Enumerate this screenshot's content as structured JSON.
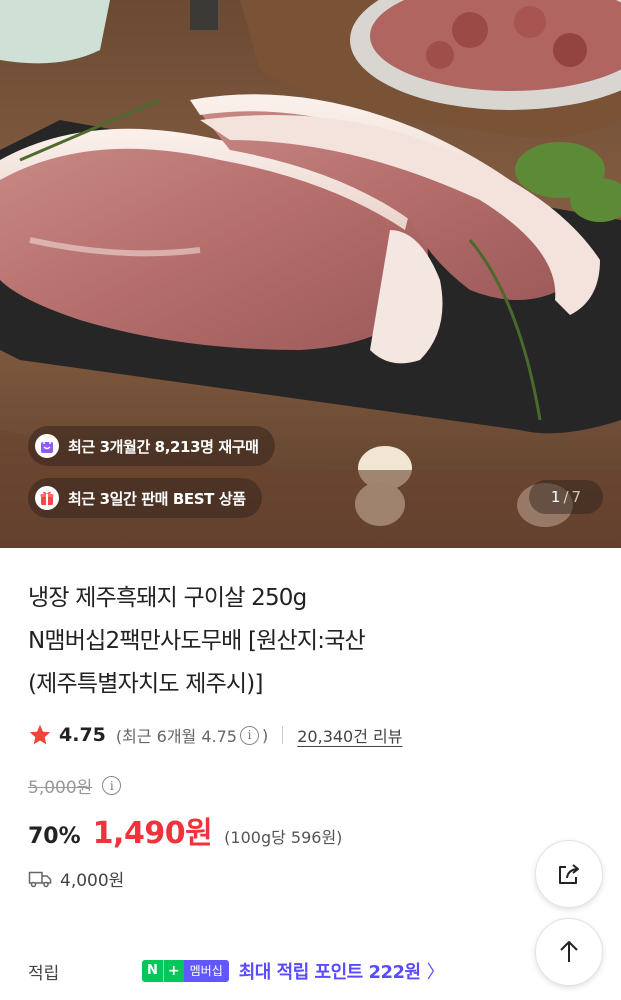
{
  "hero": {
    "badges": {
      "rebuy": {
        "icon": "shopping-bag-icon",
        "text": "최근 3개월간 8,213명 재구매"
      },
      "best": {
        "icon": "gift-icon",
        "text": "최근 3일간 판매 BEST 상품"
      }
    },
    "counter": {
      "current": "1",
      "separator": "/",
      "total": "7"
    }
  },
  "product": {
    "title_lines": [
      "냉장 제주흑돼지 구이살 250g",
      "N맴버십2팩만사도무배 [원산지:국산",
      "(제주특별자치도 제주시)]"
    ]
  },
  "rating": {
    "score": "4.75",
    "recent_prefix": "(최근 6개월 4.75",
    "recent_suffix": ")",
    "info_glyph": "i",
    "reviews": "20,340건 리뷰",
    "star_color": "#f04438"
  },
  "price": {
    "original": "5,000원",
    "info_glyph": "i",
    "discount": "70%",
    "sale": "1,490원",
    "unit": "(100g당 596원)",
    "sale_color": "#f0323c"
  },
  "shipping": {
    "icon": "delivery-truck-icon",
    "fee": "4,000원"
  },
  "points": {
    "label": "적립",
    "badge_n": "N",
    "badge_plus": "+",
    "badge_member": "멤버십",
    "text": "최대 적립 포인트 222원",
    "chevron": "〉",
    "accent": "#5b4bff",
    "naver_green": "#03c75a"
  },
  "buttons": {
    "share_icon": "share-icon",
    "top_icon": "arrow-up-icon"
  }
}
